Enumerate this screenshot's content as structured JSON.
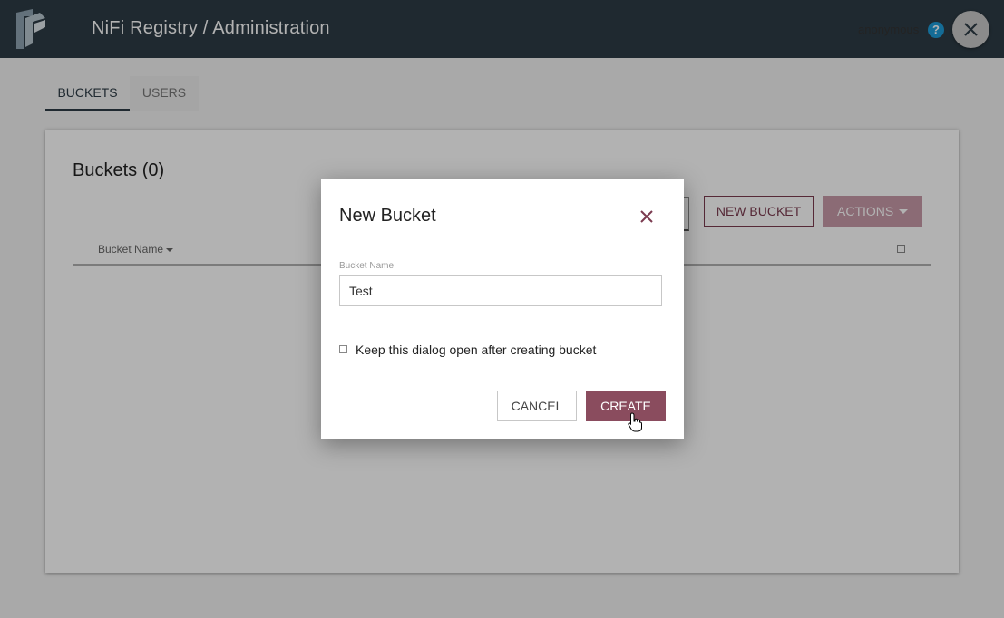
{
  "header": {
    "title": "NiFi Registry / Administration",
    "user": "anonymous",
    "help_icon": "help-icon",
    "help_glyph": "?",
    "close_icon": "close-icon",
    "brand_color": "#2d3b45"
  },
  "tabs": [
    {
      "label": "BUCKETS",
      "active": true
    },
    {
      "label": "USERS",
      "active": false
    }
  ],
  "card": {
    "title": "Buckets (0)",
    "new_bucket_label": "NEW BUCKET",
    "actions_label": "ACTIONS",
    "table": {
      "columns": [
        "Bucket Name"
      ],
      "rows": []
    }
  },
  "dialog": {
    "title": "New Bucket",
    "field_label": "Bucket Name",
    "field_value": "Test",
    "keep_open_label": "Keep this dialog open after creating bucket",
    "keep_open_checked": false,
    "cancel_label": "CANCEL",
    "create_label": "CREATE",
    "accent_color": "#8a4c5e"
  }
}
